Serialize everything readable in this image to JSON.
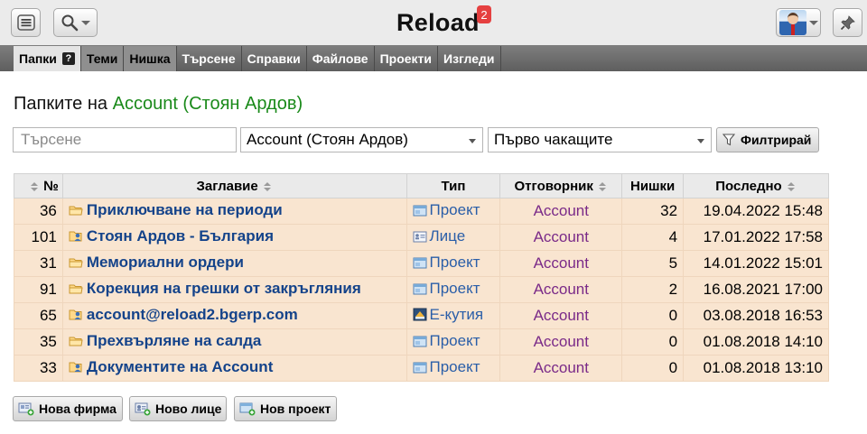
{
  "header": {
    "title": "Reload",
    "notification_count": "2"
  },
  "nav": {
    "tabs": [
      {
        "label": "Папки",
        "active": true,
        "help": "?"
      },
      {
        "label": "Теми"
      },
      {
        "label": "Нишка"
      },
      {
        "label": "Търсене"
      },
      {
        "label": "Справки"
      },
      {
        "label": "Файлове"
      },
      {
        "label": "Проекти"
      },
      {
        "label": "Изгледи"
      }
    ]
  },
  "page": {
    "title_prefix": "Папките на",
    "title_owner": "Account (Стоян Ардов)"
  },
  "filters": {
    "search_placeholder": "Търсене",
    "search_value": "",
    "user_select": "Account (Стоян Ардов)",
    "order_select": "Първо чакащите",
    "filter_button": "Филтрирай"
  },
  "table": {
    "headers": {
      "number": "№",
      "title": "Заглавие",
      "type": "Тип",
      "owner": "Отговорник",
      "threads": "Нишки",
      "last": "Последно"
    },
    "rows": [
      {
        "number": "36",
        "title": "Приключване на периоди",
        "title_icon": "folder-icon",
        "type": "Проект",
        "type_icon": "project-icon",
        "owner": "Account",
        "threads": "32",
        "last": "19.04.2022 15:48"
      },
      {
        "number": "101",
        "title": "Стоян Ардов - България",
        "title_icon": "user-folder-icon",
        "type": "Лице",
        "type_icon": "person-card-icon",
        "owner": "Account",
        "threads": "4",
        "last": "17.01.2022 17:58"
      },
      {
        "number": "31",
        "title": "Мемориални ордери",
        "title_icon": "folder-icon",
        "type": "Проект",
        "type_icon": "project-icon",
        "owner": "Account",
        "threads": "5",
        "last": "14.01.2022 15:01"
      },
      {
        "number": "91",
        "title": "Корекция на грешки от закръгляния",
        "title_icon": "folder-icon",
        "type": "Проект",
        "type_icon": "project-icon",
        "owner": "Account",
        "threads": "2",
        "last": "16.08.2021 17:00"
      },
      {
        "number": "65",
        "title": "account@reload2.bgerp.com",
        "title_icon": "user-folder-icon",
        "type": "Е-кутия",
        "type_icon": "inbox-icon",
        "owner": "Account",
        "threads": "0",
        "last": "03.08.2018 16:53"
      },
      {
        "number": "35",
        "title": "Прехвърляне на салда",
        "title_icon": "folder-icon",
        "type": "Проект",
        "type_icon": "project-icon",
        "owner": "Account",
        "threads": "0",
        "last": "01.08.2018 14:10"
      },
      {
        "number": "33",
        "title": "Документите на Account",
        "title_icon": "user-folder-icon",
        "type": "Проект",
        "type_icon": "project-icon",
        "owner": "Account",
        "threads": "0",
        "last": "01.08.2018 13:10"
      }
    ]
  },
  "actions": {
    "new_company": "Нова фирма",
    "new_person": "Ново лице",
    "new_project": "Нов проект"
  }
}
